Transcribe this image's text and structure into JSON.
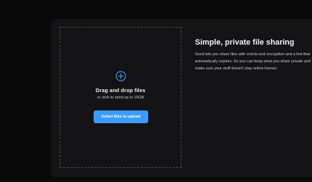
{
  "upload": {
    "icon": "plus-circle-icon",
    "title": "Drag and drop files",
    "subtitle": "or click to send up to 10GB",
    "button_label": "Select files to upload"
  },
  "info": {
    "title": "Simple, private file sharing",
    "description": "Send lets you share files with end-to-end encryption and a link that automatically expires. So you can keep what you share private and make sure your stuff doesn't stay online forever."
  },
  "colors": {
    "accent": "#3b9cff",
    "background": "#0a0a0a",
    "card": "#141416"
  }
}
